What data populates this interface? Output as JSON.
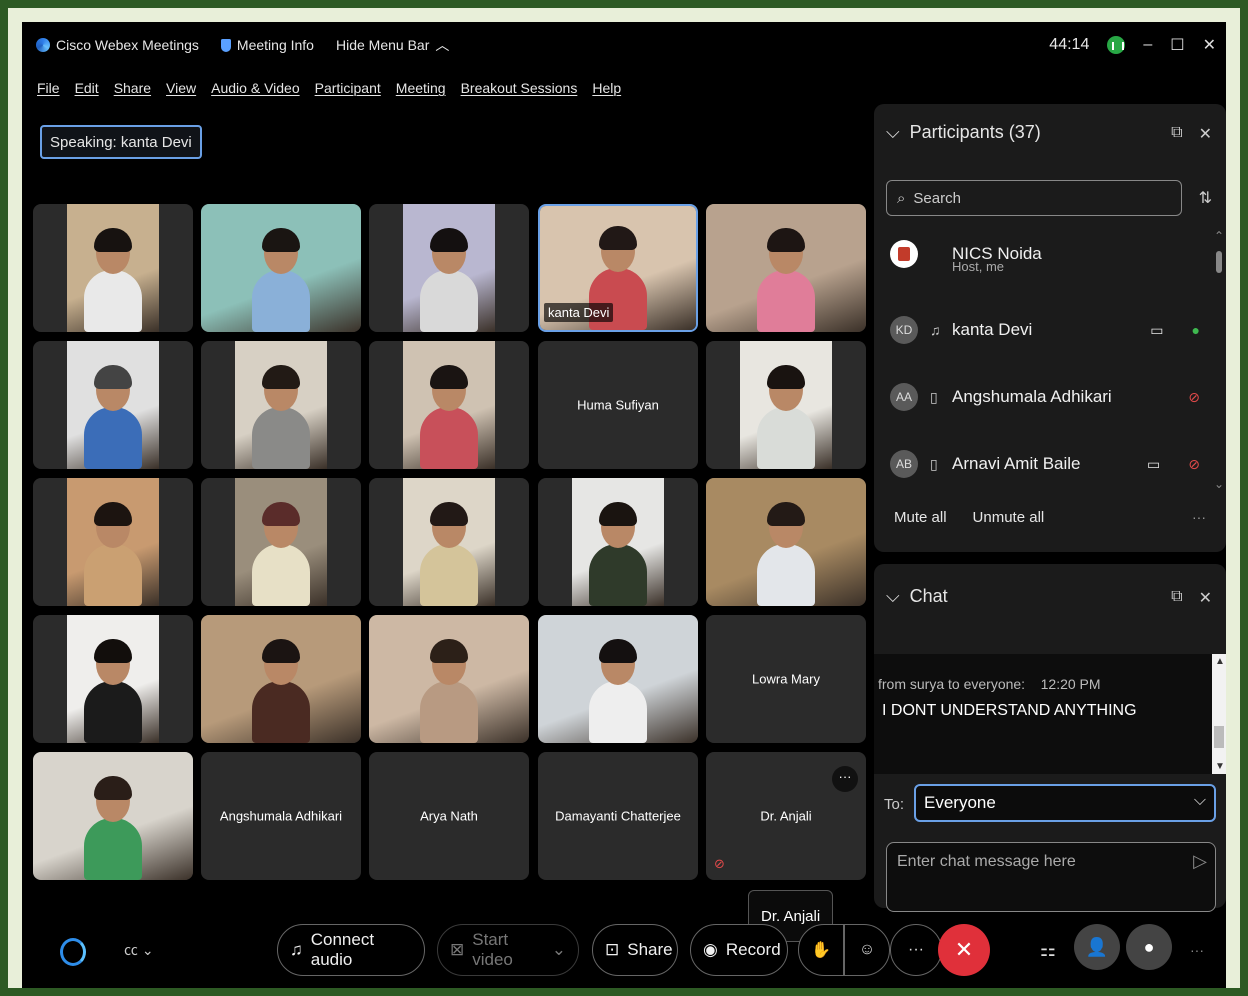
{
  "titlebar": {
    "app_name": "Cisco Webex Meetings",
    "meeting_info": "Meeting Info",
    "hide_menu": "Hide Menu Bar",
    "timer": "44:14"
  },
  "menu": [
    "File",
    "Edit",
    "Share",
    "View",
    "Audio & Video",
    "Participant",
    "Meeting",
    "Breakout Sessions",
    "Help"
  ],
  "speaking": "Speaking: kanta Devi",
  "tiles": [
    {
      "name": "",
      "label": "",
      "hair": "#171210",
      "shirt": "#e9e9e9",
      "bg": "#c7b08f",
      "narrow": true
    },
    {
      "name": "",
      "label": "",
      "hair": "#1a1512",
      "shirt": "#8ab0d8",
      "bg": "#8cc0b8",
      "narrow": false
    },
    {
      "name": "",
      "label": "",
      "hair": "#141010",
      "shirt": "#d9d9d9",
      "bg": "#b9b7d0",
      "narrow": true
    },
    {
      "name": "",
      "label": "kanta Devi",
      "hair": "#211816",
      "shirt": "#c94b50",
      "bg": "#d8c4ae",
      "narrow": false,
      "active": true
    },
    {
      "name": "",
      "label": "",
      "hair": "#1d1513",
      "shirt": "#e07d99",
      "bg": "#b8a28e",
      "narrow": false
    },
    {
      "name": "",
      "label": "",
      "hair": "#444",
      "shirt": "#3b6db8",
      "bg": "#e0e0e0",
      "narrow": true
    },
    {
      "name": "",
      "label": "",
      "hair": "#221a15",
      "shirt": "#8a8a88",
      "bg": "#d7d0c4",
      "narrow": true
    },
    {
      "name": "",
      "label": "",
      "hair": "#1a1412",
      "shirt": "#c8505a",
      "bg": "#cfc2b2",
      "narrow": true
    },
    {
      "name": "Huma Sufiyan",
      "label": "",
      "video": false
    },
    {
      "name": "",
      "label": "",
      "hair": "#191310",
      "shirt": "#d9dcd8",
      "bg": "#e8e6e0",
      "narrow": true
    },
    {
      "name": "",
      "label": "",
      "hair": "#1c1410",
      "shirt": "#caa072",
      "bg": "#c89a70",
      "narrow": true
    },
    {
      "name": "",
      "label": "",
      "hair": "#5a2c2a",
      "shirt": "#e7e0c6",
      "bg": "#9a8e7c",
      "narrow": true
    },
    {
      "name": "",
      "label": "",
      "hair": "#221916",
      "shirt": "#d4c49a",
      "bg": "#ddd6c8",
      "narrow": true
    },
    {
      "name": "",
      "label": "",
      "hair": "#1a1410",
      "shirt": "#2f3a2a",
      "bg": "#e6e6e4",
      "narrow": true
    },
    {
      "name": "",
      "label": "",
      "hair": "#231a16",
      "shirt": "#e3e6ea",
      "bg": "#a88a62",
      "narrow": false
    },
    {
      "name": "",
      "label": "",
      "hair": "#120e0c",
      "shirt": "#1b1b1b",
      "bg": "#efeeec",
      "narrow": true
    },
    {
      "name": "",
      "label": "",
      "hair": "#1b1412",
      "shirt": "#4a2a22",
      "bg": "#b79a7a",
      "narrow": false
    },
    {
      "name": "",
      "label": "",
      "hair": "#2c2018",
      "shirt": "#b89a82",
      "bg": "#cdb8a4",
      "narrow": false
    },
    {
      "name": "",
      "label": "",
      "hair": "#141010",
      "shirt": "#eeeeee",
      "bg": "#cfd4d8",
      "narrow": false
    },
    {
      "name": "Lowra Mary",
      "label": "",
      "video": false
    },
    {
      "name": "",
      "label": "",
      "hair": "#2a1e18",
      "shirt": "#3d9a5a",
      "bg": "#d8d4cc",
      "narrow": false
    },
    {
      "name": "Angshumala Adhikari",
      "label": "",
      "video": false
    },
    {
      "name": "Arya Nath",
      "label": "",
      "video": false
    },
    {
      "name": "Damayanti Chatterjee",
      "label": "",
      "video": false
    },
    {
      "name": "Dr. Anjali",
      "label": "",
      "video": false,
      "more": true,
      "muted": true
    }
  ],
  "participants": {
    "header": "Participants (37)",
    "search_placeholder": "Search",
    "list": [
      {
        "initials": "",
        "name": "NICS Noida",
        "sub": "Host, me",
        "host": true
      },
      {
        "initials": "KD",
        "name": "kanta Devi",
        "device": "headset",
        "video": true,
        "mic": "on"
      },
      {
        "initials": "AA",
        "name": "Angshumala Adhikari",
        "device": "phone",
        "video": false,
        "mic": "off"
      },
      {
        "initials": "AB",
        "name": "Arnavi Amit Baile",
        "device": "phone",
        "video": true,
        "mic": "off"
      }
    ],
    "mute_all": "Mute all",
    "unmute_all": "Unmute all"
  },
  "chat": {
    "header": "Chat",
    "from": "from surya to everyone:",
    "time": "12:20 PM",
    "message": "I DONT UNDERSTAND ANYTHING",
    "to_label": "To:",
    "to_value": "Everyone",
    "input_placeholder": "Enter chat message here"
  },
  "bottom": {
    "connect_audio": "Connect audio",
    "start_video": "Start video",
    "share": "Share",
    "record": "Record",
    "tooltip": "Dr. Anjali"
  },
  "colors": {
    "accent": "#6aa0e6",
    "end_call": "#e0303a",
    "mic_on": "#3fb950",
    "mic_off": "#e34a4a"
  }
}
